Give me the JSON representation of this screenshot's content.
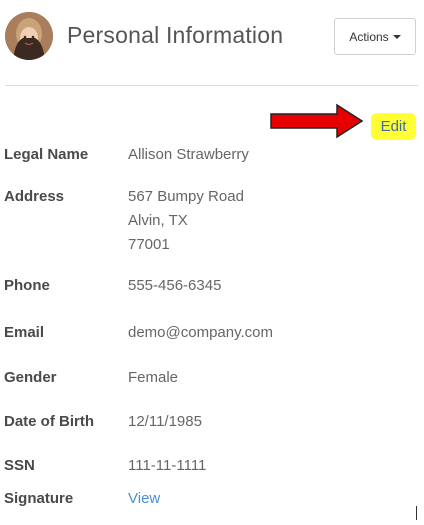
{
  "header": {
    "title": "Personal Information",
    "actions_label": "Actions"
  },
  "edit_label": "Edit",
  "fields": {
    "legal_name": {
      "label": "Legal Name",
      "value": "Allison Strawberry"
    },
    "address": {
      "label": "Address",
      "line1": "567 Bumpy Road",
      "line2": "Alvin, TX",
      "line3": "77001"
    },
    "phone": {
      "label": "Phone",
      "value": "555-456-6345"
    },
    "email": {
      "label": "Email",
      "value": "demo@company.com"
    },
    "gender": {
      "label": "Gender",
      "value": "Female"
    },
    "dob": {
      "label": "Date of Birth",
      "value": "12/11/1985"
    },
    "ssn": {
      "label": "SSN",
      "value": "111-11-1111"
    },
    "signature": {
      "label": "Signature",
      "link": "View"
    }
  },
  "colors": {
    "arrow": "#e60000",
    "highlight": "#ffff33",
    "link": "#4a8fd6"
  },
  "icons": {
    "avatar": "user-avatar-photo",
    "caret": "caret-down-icon",
    "arrow": "red-arrow-annotation"
  }
}
